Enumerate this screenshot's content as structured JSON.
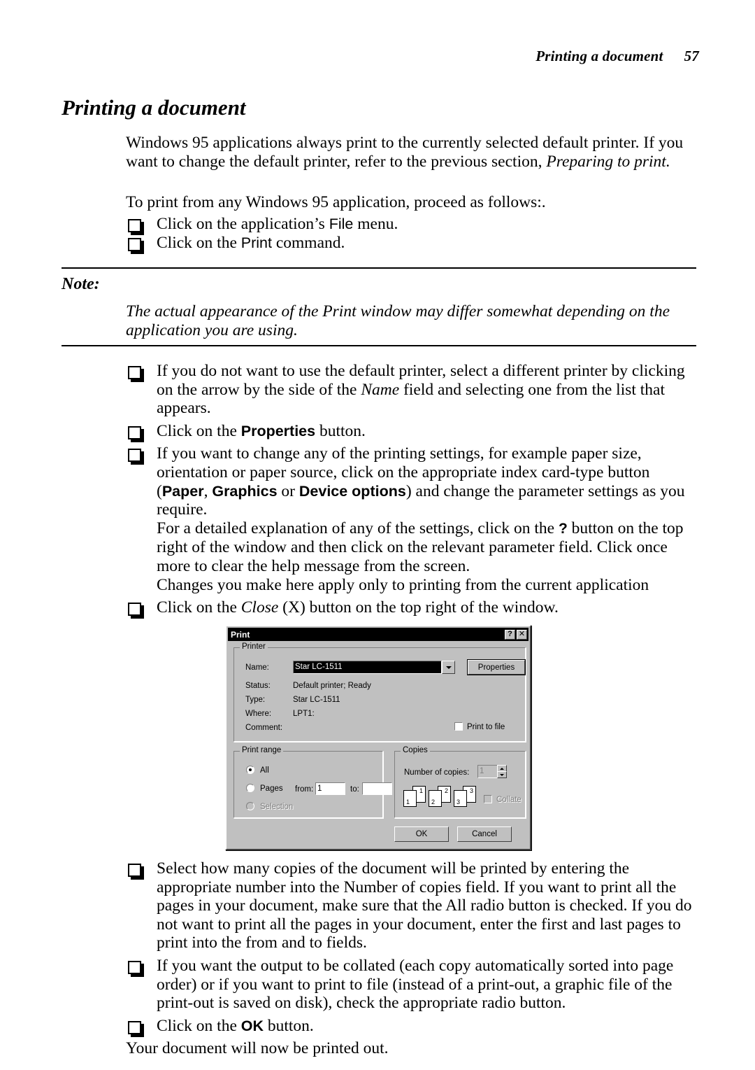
{
  "header": {
    "title": "Printing a document",
    "page_number": "57"
  },
  "section": {
    "title": "Printing a document"
  },
  "intro": {
    "p1_a": "Windows 95 applications always print to the currently selected default printer. If you want to change the default printer, refer to the previous section, ",
    "p1_b": "Preparing to print.",
    "p2": "To print from any Windows 95 application, proceed as follows:."
  },
  "steps_top": [
    {
      "pre": "Click on the application’s ",
      "em": "File",
      "post": " menu."
    },
    {
      "pre": "Click on the ",
      "em": "Print",
      "post": " command."
    }
  ],
  "note": {
    "label": "Note:",
    "text": "The actual appearance of the Print window may differ somewhat depending on the application you are using."
  },
  "steps_mid": {
    "item1_a": "If you do not want to use the default printer, select a different printer by clicking on the arrow by the side of the ",
    "item1_em": "Name",
    "item1_b": " field and selecting one from the list that appears.",
    "item2_a": "Click on the ",
    "item2_b": "Properties",
    "item2_c": " button.",
    "item3_a": "If you want to change any of the printing settings, for example paper size, orientation or paper source, click on the appropriate index card-type button (",
    "item3_paper": "Paper",
    "item3_sep1": ", ",
    "item3_graphics": "Graphics",
    "item3_sep2": " or ",
    "item3_device": "Device options",
    "item3_b": ") and change the parameter settings as you require.",
    "item3_line2_a": "For a detailed explanation of any of the settings, click on the ",
    "item3_qmark": "?",
    "item3_line2_b": " button on the top right of the window and then click on the relevant parameter field. Click once more to clear the help message from the screen.",
    "item3_line3": "Changes you make here apply only to printing from the current application",
    "item4_a": "Click on the ",
    "item4_em": "Close",
    "item4_b": " (X) button on the top right of the window."
  },
  "steps_bottom": {
    "item1": "Select how many copies of the document will be printed by entering the appropriate number into the Number of copies field. If you want to print all the pages in your document, make sure that the All radio button is checked. If you do not want to print all the pages in your document, enter the first and last pages to print into the from and to fields.",
    "item2": "If you want the output to be collated (each copy automatically sorted into page order) or if you want to print to file (instead of a print-out, a graphic file of the print-out is saved on disk), check the appropriate radio button.",
    "item3_a": "Click on the ",
    "item3_b": "OK",
    "item3_c": " button.",
    "closing": "Your document will now be printed out."
  },
  "print_dialog": {
    "title": "Print",
    "titlebar_buttons": {
      "help": "?",
      "close": "✕"
    },
    "printer_group": {
      "legend": "Printer",
      "name_label": "Name:",
      "name_value": "Star LC-1511",
      "properties_button": "Properties",
      "status_label": "Status:",
      "status_value": "Default printer; Ready",
      "type_label": "Type:",
      "type_value": "Star LC-1511",
      "where_label": "Where:",
      "where_value": "LPT1:",
      "comment_label": "Comment:",
      "comment_value": "",
      "print_to_file_label": "Print to file",
      "print_to_file_checked": false
    },
    "print_range_group": {
      "legend": "Print range",
      "all_label": "All",
      "all_selected": true,
      "pages_label": "Pages",
      "from_label": "from:",
      "from_value": "1",
      "to_label": "to:",
      "to_value": "",
      "selection_label": "Selection",
      "selection_disabled": true
    },
    "copies_group": {
      "legend": "Copies",
      "number_label": "Number of copies:",
      "number_value": "1",
      "collate_label": "Collate",
      "collate_checked": false,
      "page_icons": [
        {
          "front": "1",
          "back": "1"
        },
        {
          "front": "2",
          "back": "2"
        },
        {
          "front": "3",
          "back": "3"
        }
      ]
    },
    "ok_button": "OK",
    "cancel_button": "Cancel"
  }
}
